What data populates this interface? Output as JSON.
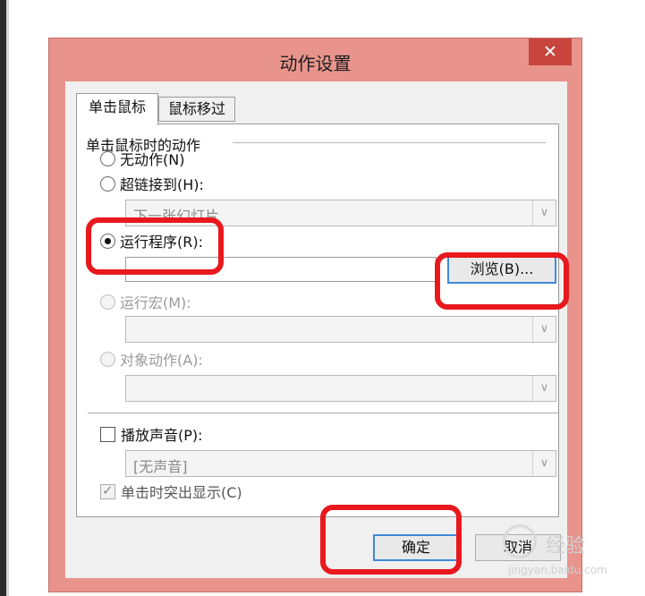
{
  "dialog": {
    "title": "动作设置",
    "close_glyph": "✕"
  },
  "tabs": [
    {
      "label": "单击鼠标",
      "active": true
    },
    {
      "label": "鼠标移过",
      "active": false
    }
  ],
  "group": {
    "title": "单击鼠标时的动作"
  },
  "options": {
    "no_action": "无动作(N)",
    "hyperlink": "超链接到(H):",
    "hyperlink_value": "下一张幻灯片",
    "run_program": "运行程序(R):",
    "run_program_value": "",
    "browse_button": "浏览(B)...",
    "run_macro": "运行宏(M):",
    "object_action": "对象动作(A):"
  },
  "sound": {
    "checkbox_label": "播放声音(P):",
    "checked": false,
    "value": "[无声音]"
  },
  "highlight": {
    "label": "单击时突出显示(C)",
    "checked": true
  },
  "buttons": {
    "ok": "确定",
    "cancel": "取消"
  },
  "colors": {
    "annotation_red": "#e8181d",
    "title_bar": "#e8948c",
    "close_button": "#c7453c",
    "focus_blue": "#3b8ad9"
  },
  "watermark": {
    "text": "经验",
    "url": "jingyan.baidu.com"
  }
}
